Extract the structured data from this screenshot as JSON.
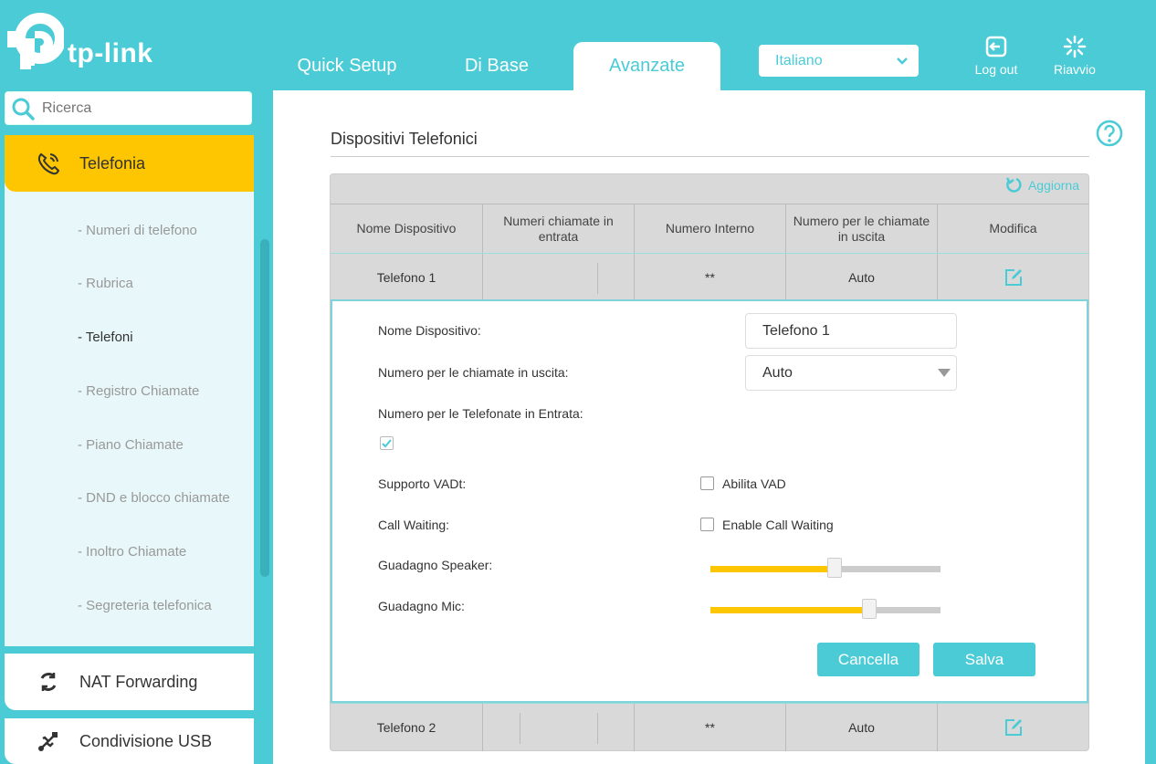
{
  "header": {
    "logo_text": "tp-link",
    "tabs": [
      {
        "label": "Quick Setup"
      },
      {
        "label": "Di Base"
      },
      {
        "label": "Avanzate"
      }
    ],
    "language": "Italiano",
    "logout_label": "Log out",
    "reboot_label": "Riavvio"
  },
  "sidebar": {
    "search_placeholder": "Ricerca",
    "active_section": "Telefonia",
    "sub_items": [
      "- Numeri di telefono",
      "- Rubrica",
      "- Telefoni",
      "- Registro Chiamate",
      "- Piano Chiamate",
      "- DND e blocco chiamate",
      "- Inoltro Chiamate",
      "- Segreteria telefonica"
    ],
    "other_sections": [
      "NAT Forwarding",
      "Condivisione USB"
    ]
  },
  "main": {
    "title": "Dispositivi Telefonici",
    "refresh_label": "Aggiorna",
    "columns": [
      "Nome Dispositivo",
      "Numeri chiamate in entrata",
      "Numero Interno",
      "Numero per le chiamate in uscita",
      "Modifica"
    ],
    "rows": [
      {
        "name": "Telefono 1",
        "incoming": "",
        "internal": "**",
        "outgoing": "Auto"
      },
      {
        "name": "Telefono 2",
        "incoming": "",
        "internal": "**",
        "outgoing": "Auto"
      }
    ],
    "form": {
      "name_label": "Nome Dispositivo:",
      "name_value": "Telefono 1",
      "outgoing_label": "Numero per le chiamate in uscita:",
      "outgoing_value": "Auto",
      "incoming_label": "Numero per le Telefonate in Entrata:",
      "incoming_checked": true,
      "vad_label": "Supporto VADt:",
      "vad_checkbox_label": "Abilita VAD",
      "vad_checked": false,
      "callwait_label": "Call Waiting:",
      "callwait_checkbox_label": "Enable Call Waiting",
      "callwait_checked": false,
      "speaker_label": "Guadagno Speaker:",
      "speaker_level": 0.54,
      "mic_label": "Guadagno Mic:",
      "mic_level": 0.69,
      "cancel_label": "Cancella",
      "save_label": "Salva"
    }
  },
  "colors": {
    "accent": "#4acbd6",
    "highlight": "#fdc600"
  }
}
